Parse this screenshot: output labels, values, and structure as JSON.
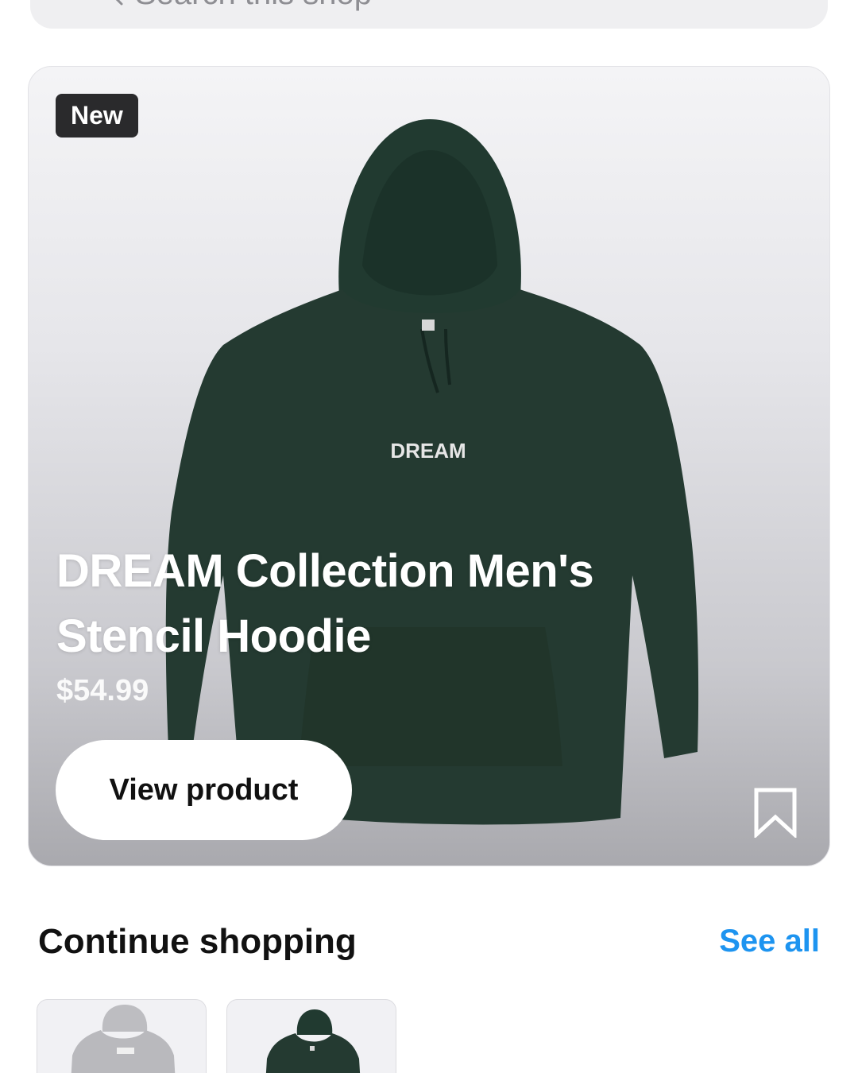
{
  "search": {
    "placeholder": "Search this shop"
  },
  "featured": {
    "badge": "New",
    "print_text": "DREAM",
    "title": "DREAM Collection Men's Stencil Hoodie",
    "price": "$54.99",
    "view_button_label": "View product",
    "bookmark_icon": "bookmark-icon",
    "hoodie_color": "#243a31"
  },
  "continue_shopping": {
    "title": "Continue shopping",
    "see_all_label": "See all",
    "items": [
      {
        "image": "grey-hoodie",
        "color": "#b9b9bd"
      },
      {
        "image": "green-hoodie",
        "color": "#243a31"
      }
    ]
  },
  "colors": {
    "accent_link": "#1d94f0",
    "badge_bg": "#2a2a2c"
  }
}
